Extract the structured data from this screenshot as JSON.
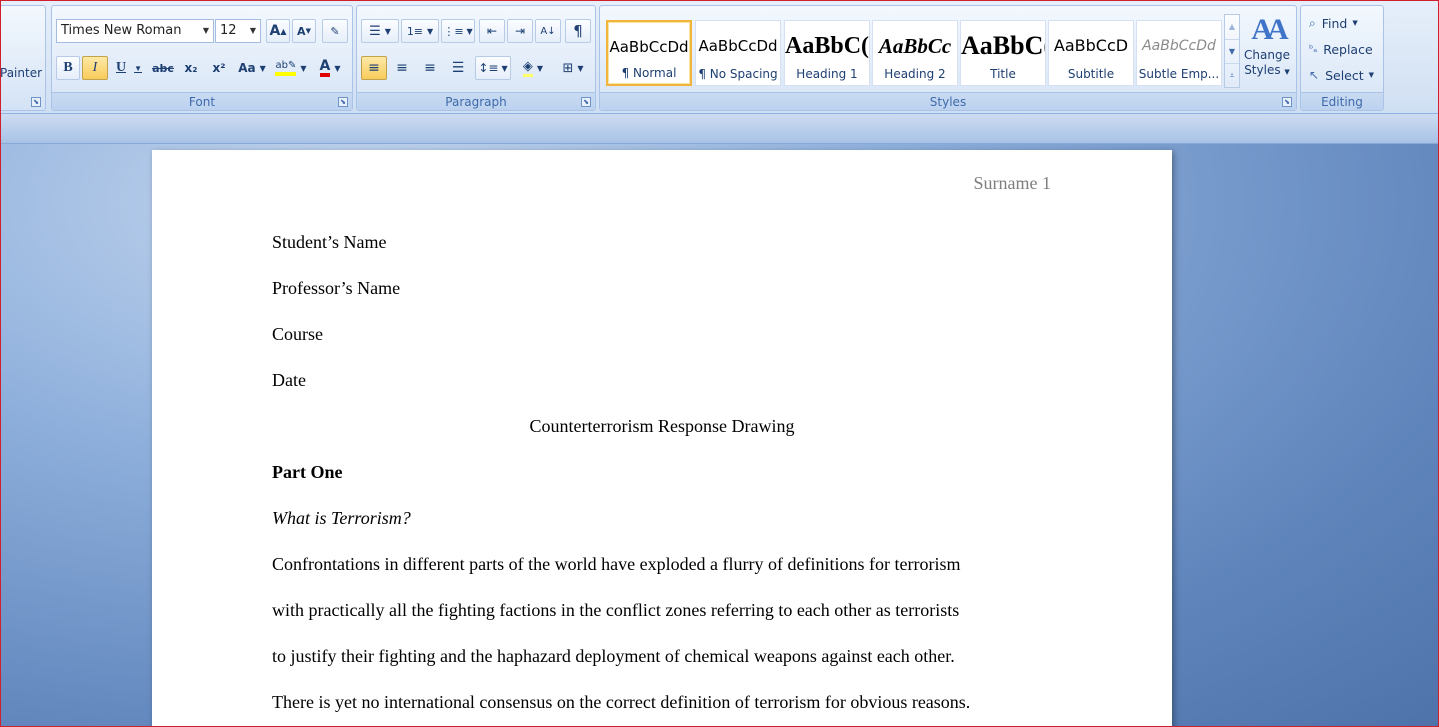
{
  "clipboard": {
    "painter_label": "Painter"
  },
  "font": {
    "name": "Times New Roman",
    "size": "12",
    "group_label": "Font",
    "grow_label": "A",
    "shrink_label": "A",
    "bold_label": "B",
    "italic_label": "I",
    "underline_label": "U",
    "strike_label": "abc",
    "sub_label": "x₂",
    "sup_label": "x²",
    "case_label": "Aa",
    "highlight_label": "ab",
    "color_label": "A",
    "highlight_color": "#ffff00",
    "font_color": "#e00000"
  },
  "paragraph": {
    "group_label": "Paragraph",
    "show_marks_label": "¶"
  },
  "styles": {
    "group_label": "Styles",
    "change_styles_line1": "Change",
    "change_styles_line2": "Styles",
    "items": [
      {
        "sample": "AaBbCcDd",
        "name": "¶ Normal"
      },
      {
        "sample": "AaBbCcDd",
        "name": "¶ No Spacing"
      },
      {
        "sample": "AaBbC(",
        "name": "Heading 1"
      },
      {
        "sample": "AaBbCc",
        "name": "Heading 2"
      },
      {
        "sample": "AaBbC(",
        "name": "Title"
      },
      {
        "sample": "AaBbCcD",
        "name": "Subtitle"
      },
      {
        "sample": "AaBbCcDd",
        "name": "Subtle Emp..."
      }
    ]
  },
  "editing": {
    "group_label": "Editing",
    "find_label": "Find",
    "replace_label": "Replace",
    "select_label": "Select"
  },
  "document": {
    "header": "Surname 1",
    "student": "Student’s Name",
    "professor": "Professor’s Name",
    "course": "Course",
    "date": "Date",
    "title": "Counterterrorism Response Drawing",
    "part_heading": "Part One",
    "question": "What is Terrorism?",
    "paragraph_lines": [
      "Confrontations in different parts of the world have exploded a flurry of definitions for terrorism",
      "with practically all the fighting factions in the conflict zones referring to each other as terrorists",
      "to justify their fighting and the haphazard deployment of chemical weapons against each other.",
      "There is yet no international consensus on the correct definition of terrorism for obvious reasons."
    ]
  }
}
